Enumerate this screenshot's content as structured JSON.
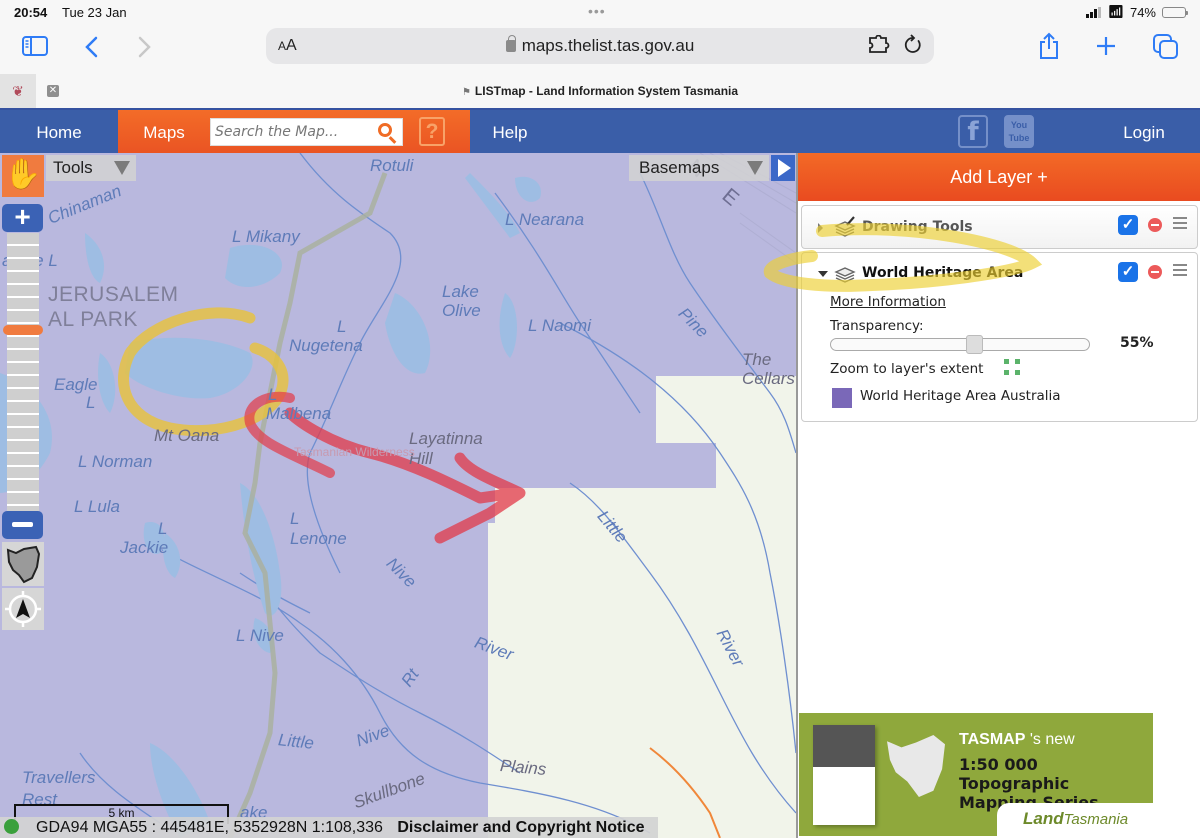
{
  "status_bar": {
    "time": "20:54",
    "date": "Tue 23 Jan",
    "battery_text": "74%",
    "battery_level": 0.74
  },
  "browser": {
    "text_size_label": "AA",
    "url": "maps.thelist.tas.gov.au",
    "tab_title": "LISTmap - Land Information System Tasmania",
    "icons": [
      "sidebar-icon",
      "back-icon",
      "forward-icon",
      "lock-icon",
      "extension-icon",
      "reload-icon",
      "share-icon",
      "new-tab-icon",
      "tabs-overview-icon"
    ]
  },
  "nav": {
    "home": "Home",
    "maps": "Maps",
    "search_placeholder": "Search the Map...",
    "help_icon": "?",
    "help": "Help",
    "facebook": "f",
    "youtube_top": "You",
    "youtube_bottom": "Tube",
    "login": "Login"
  },
  "map": {
    "tools_label": "Tools",
    "basemaps_label": "Basemaps",
    "zoom_level_fraction": 0.35,
    "scale_bar_label": "5 km",
    "coords_text": "GDA94 MGA55 : 445481E, 5352928N 1:108,336",
    "disclaimer": "Disclaimer and Copyright Notice",
    "labels": {
      "chinaman": "Chinaman",
      "rotuli": "Rotuli",
      "l_mikany": "L Mikany",
      "l_nearana": "L Nearana",
      "ne": "N E",
      "triangle_l": "angle L",
      "park_1": "JERUSALEM",
      "park_2": "AL PARK",
      "lake_olive_1": "Lake",
      "lake_olive_2": "Olive",
      "l_naomi": "L Naomi",
      "pine": "Pine",
      "l_nugetena_1": "L",
      "l_nugetena_2": "Nugetena",
      "the_cellars_1": "The",
      "the_cellars_2": "Cellars",
      "eagle_1": "Eagle",
      "eagle_2": "L",
      "l_malbena_1": "L",
      "l_malbena_2": "Malbena",
      "mt_oana": "Mt Oana",
      "layatinna_1": "Layatinna",
      "layatinna_2": "Hill",
      "tas_wilderness": "Tasmanian Wilderness",
      "l_norman": "L Norman",
      "l_lula": "L Lula",
      "l_lenone_1": "L",
      "l_lenone_2": "Lenone",
      "little_1": "Little",
      "l_jackie_1": "L",
      "l_jackie_2": "Jackie",
      "nive_1": "Nive",
      "river_1": "River",
      "river_2": "River",
      "l_nive": "L Nive",
      "rt": "Rt",
      "little_2": "Little",
      "nive_2": "Nive",
      "travellers_1": "Travellers",
      "travellers_2": "Rest",
      "plains": "Plains",
      "skullbone": "Skullbone",
      "lake_tail": "ake"
    },
    "colors": {
      "wha_overlay": "#b9b8de",
      "water": "#9ebde3",
      "river": "#6f8fd0",
      "track": "#a9b0a0",
      "basemap_land": "#f1f4ea",
      "annotation_yellow": "#e8c23a",
      "annotation_red": "#e23a48"
    }
  },
  "panel": {
    "add_layer": "Add Layer +",
    "layers": [
      {
        "title": "Drawing Tools",
        "expanded": false,
        "visible": true
      },
      {
        "title": "World Heritage Area",
        "expanded": true,
        "visible": true,
        "more_info": "More Information",
        "transparency_label": "Transparency:",
        "transparency_value": "55%",
        "transparency_fraction": 0.55,
        "zoom_extent": "Zoom to layer's extent",
        "legend_label": "World Heritage Area Australia",
        "legend_color": "#7a68b8"
      }
    ],
    "ad": {
      "brand": "TASMAP",
      "brand_suffix": "'s new",
      "headline_1": "1:50 000 Topographic",
      "headline_2": "Mapping Series",
      "footer_bold": "Land",
      "footer_italic": "Tasmania"
    }
  },
  "colors": {
    "nav_blue": "#3a5ea8",
    "nav_orange": "#ee5d24",
    "checkbox_blue": "#1a73e8",
    "ad_green": "#8fa83c"
  }
}
